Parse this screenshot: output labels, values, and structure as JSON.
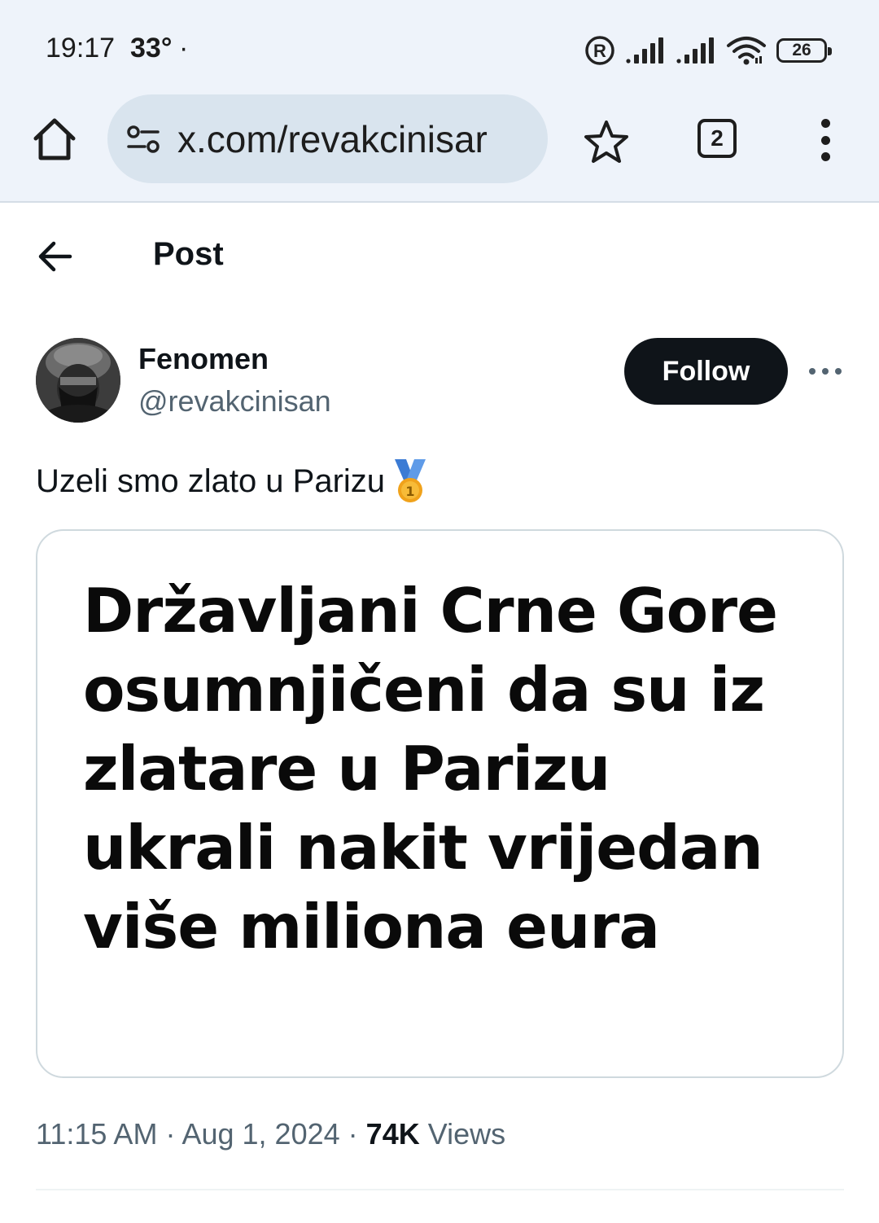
{
  "status_bar": {
    "time": "19:17",
    "temperature": "33°",
    "dot": "·",
    "battery": "26",
    "icons": [
      "registered-icon",
      "signal-icon",
      "signal-icon",
      "wifi-icon",
      "battery-icon"
    ]
  },
  "browser": {
    "url": "x.com/revakcinisar",
    "tab_count": "2"
  },
  "page": {
    "title": "Post"
  },
  "post": {
    "author_name": "Fenomen",
    "author_handle": "@revakcinisan",
    "follow_label": "Follow",
    "text": "Uzeli smo zlato u Parizu",
    "emoji": "1st-place-medal",
    "media_headline": "Državljani Crne Gore osumnjičeni da su iz zlatare u Parizu ukrali nakit vrijedan više miliona eura",
    "time": "11:15 AM",
    "date": "Aug 1, 2024",
    "separator": "·",
    "views_count": "74K",
    "views_label": "Views"
  },
  "colors": {
    "chrome_bg": "#eef3fa",
    "url_bar_bg": "#d9e4ee",
    "follow_bg": "#0f1419",
    "secondary_text": "#536471",
    "card_border": "#cfd9de"
  }
}
